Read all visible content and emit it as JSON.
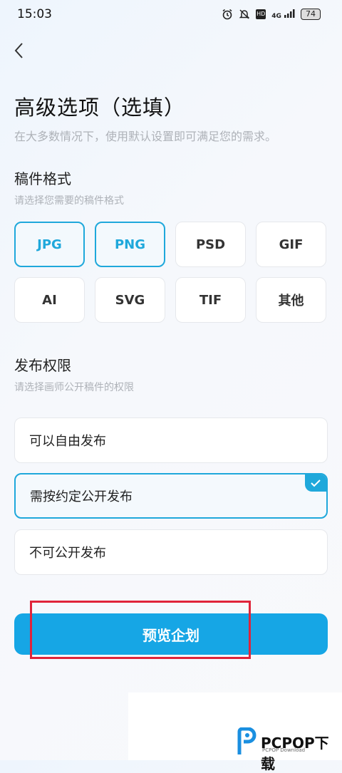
{
  "status_bar": {
    "time": "15:03",
    "network": "4G",
    "hd": "HD",
    "battery": "74"
  },
  "page": {
    "title": "高级选项（选填）",
    "subtitle": "在大多数情况下，使用默认设置即可满足您的需求。"
  },
  "format_section": {
    "title": "稿件格式",
    "hint": "请选择您需要的稿件格式",
    "options": [
      {
        "label": "JPG",
        "selected": true
      },
      {
        "label": "PNG",
        "selected": true
      },
      {
        "label": "PSD",
        "selected": false
      },
      {
        "label": "GIF",
        "selected": false
      },
      {
        "label": "AI",
        "selected": false
      },
      {
        "label": "SVG",
        "selected": false
      },
      {
        "label": "TIF",
        "selected": false
      },
      {
        "label": "其他",
        "selected": false
      }
    ]
  },
  "permission_section": {
    "title": "发布权限",
    "hint": "请选择画师公开稿件的权限",
    "options": [
      {
        "label": "可以自由发布",
        "selected": false
      },
      {
        "label": "需按约定公开发布",
        "selected": true
      },
      {
        "label": "不可公开发布",
        "selected": false
      }
    ]
  },
  "actions": {
    "preview_label": "预览企划"
  },
  "watermark": {
    "brand": "PCPOP下载",
    "sub": "PCPOP Download"
  },
  "colors": {
    "accent": "#1fa8db",
    "button": "#16a6e5",
    "highlight_box": "#e0243a"
  },
  "icons": {
    "back": "chevron-left-icon",
    "check": "check-icon"
  }
}
